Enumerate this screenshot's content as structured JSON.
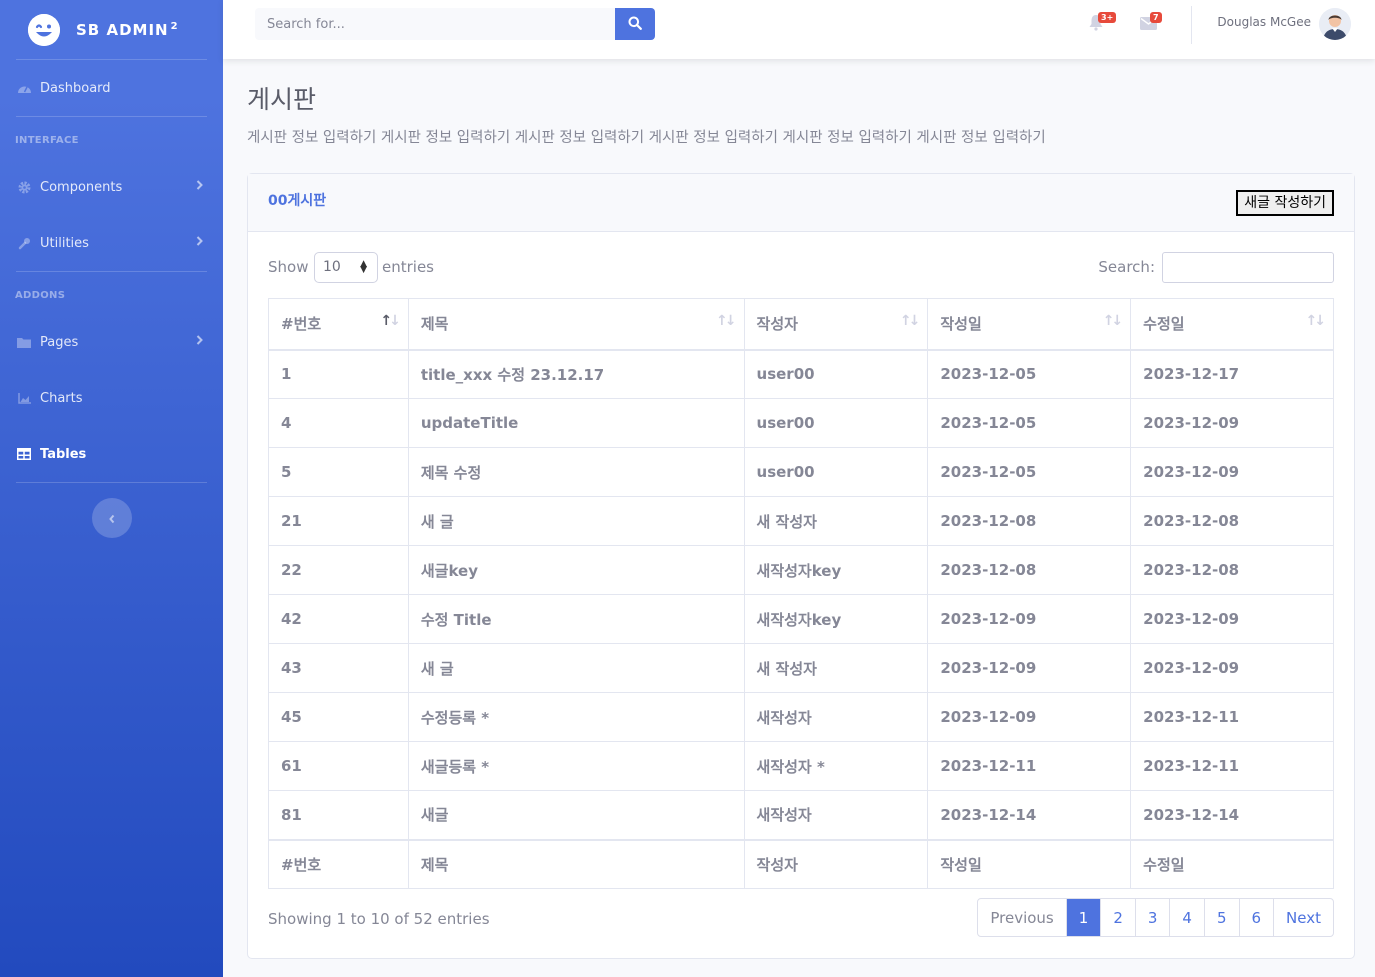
{
  "sidebar": {
    "brand": "SB ADMIN",
    "brand_sup": "2",
    "dashboard": "Dashboard",
    "heading_interface": "INTERFACE",
    "components": "Components",
    "utilities": "Utilities",
    "heading_addons": "ADDONS",
    "pages": "Pages",
    "charts": "Charts",
    "tables": "Tables"
  },
  "topbar": {
    "search_placeholder": "Search for...",
    "alerts_badge": "3+",
    "messages_badge": "7",
    "user_name": "Douglas McGee"
  },
  "page": {
    "title": "게시판",
    "description": "게시판 정보 입력하기 게시판 정보 입력하기 게시판 정보 입력하기 게시판 정보 입력하기 게시판 정보 입력하기 게시판 정보 입력하기"
  },
  "card": {
    "title": "00게시판",
    "new_button": "새글 작성하기",
    "show_label": "Show",
    "entries_value": "10",
    "entries_label": "entries",
    "search_label": "Search:",
    "columns": [
      "#번호",
      "제목",
      "작성자",
      "작성일",
      "수정일"
    ],
    "rows": [
      [
        "1",
        "title_xxx 수정 23.12.17",
        "user00",
        "2023-12-05",
        "2023-12-17"
      ],
      [
        "4",
        "updateTitle",
        "user00",
        "2023-12-05",
        "2023-12-09"
      ],
      [
        "5",
        "제목 수정",
        "user00",
        "2023-12-05",
        "2023-12-09"
      ],
      [
        "21",
        "새 글",
        "새 작성자",
        "2023-12-08",
        "2023-12-08"
      ],
      [
        "22",
        "새글key",
        "새작성자key",
        "2023-12-08",
        "2023-12-08"
      ],
      [
        "42",
        "수정 Title",
        "새작성자key",
        "2023-12-09",
        "2023-12-09"
      ],
      [
        "43",
        "새 글",
        "새 작성자",
        "2023-12-09",
        "2023-12-09"
      ],
      [
        "45",
        "수정등록 *",
        "새작성자",
        "2023-12-09",
        "2023-12-11"
      ],
      [
        "61",
        "새글등록 *",
        "새작성자 *",
        "2023-12-11",
        "2023-12-11"
      ],
      [
        "81",
        "새글",
        "새작성자",
        "2023-12-14",
        "2023-12-14"
      ]
    ],
    "info": "Showing 1 to 10 of 52 entries",
    "pagination": {
      "previous": "Previous",
      "pages": [
        "1",
        "2",
        "3",
        "4",
        "5",
        "6"
      ],
      "active": "1",
      "next": "Next"
    }
  },
  "colors": {
    "primary": "#4e73df",
    "sidebar_dark": "#224abe",
    "badge": "#e74a3b",
    "text": "#858796"
  }
}
